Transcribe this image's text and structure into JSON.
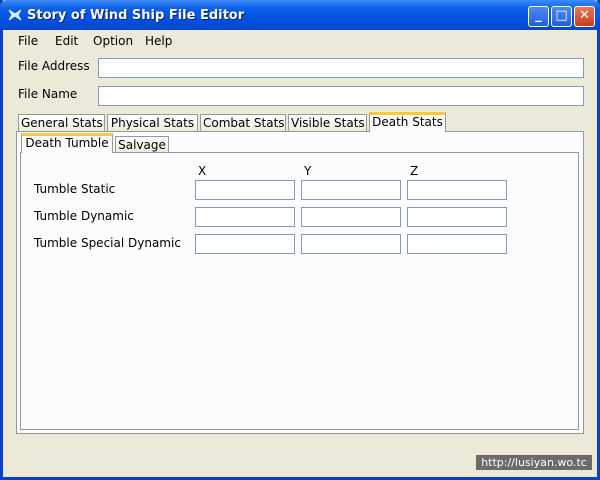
{
  "window": {
    "title": "Story of Wind Ship File Editor",
    "controls": {
      "minimize": "_",
      "maximize": "□",
      "close": "✕"
    }
  },
  "menu": [
    "File",
    "Edit",
    "Option",
    "Help"
  ],
  "fields": {
    "file_address": {
      "label": "File Address",
      "value": ""
    },
    "file_name": {
      "label": "File Name",
      "value": ""
    }
  },
  "tabs": [
    "General Stats",
    "Physical Stats",
    "Combat Stats",
    "Visible Stats",
    "Death Stats"
  ],
  "active_tab": "Death Stats",
  "subtabs": [
    "Death Tumble",
    "Salvage"
  ],
  "active_subtab": "Death Tumble",
  "grid": {
    "columns": [
      "X",
      "Y",
      "Z"
    ],
    "rows": [
      {
        "label": "Tumble Static",
        "values": [
          "",
          "",
          ""
        ]
      },
      {
        "label": "Tumble Dynamic",
        "values": [
          "",
          "",
          ""
        ]
      },
      {
        "label": "Tumble Special Dynamic",
        "values": [
          "",
          "",
          ""
        ]
      }
    ]
  },
  "watermark": "http://lusiyan.wo.tc",
  "colors": {
    "titlebar": "#0050e0",
    "active_tab_accent": "#ffc83c",
    "window_bg": "#ece9d8"
  }
}
